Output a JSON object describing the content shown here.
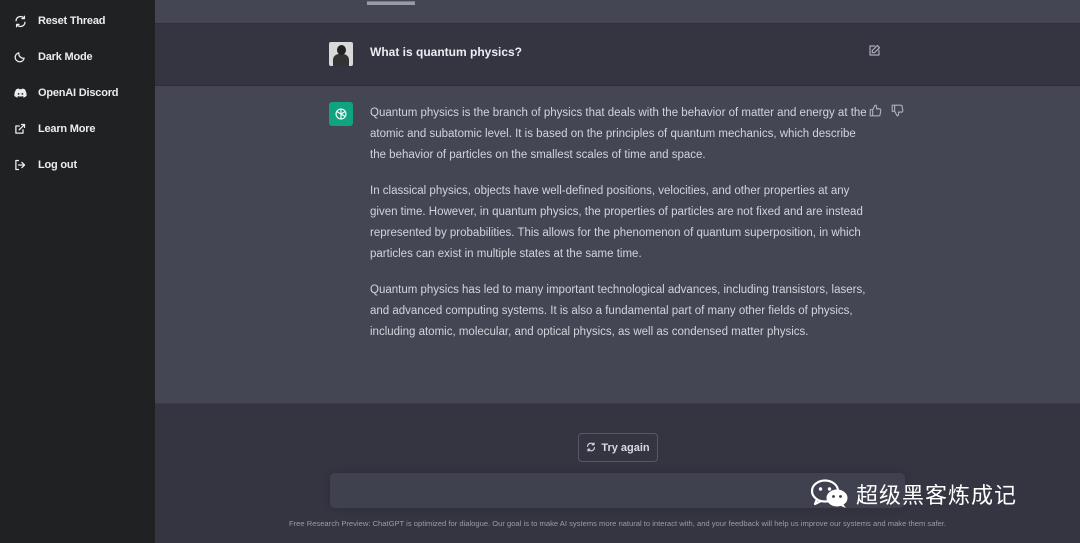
{
  "sidebar": {
    "items": [
      {
        "label": "Reset Thread",
        "icon": "refresh-icon"
      },
      {
        "label": "Dark Mode",
        "icon": "moon-icon"
      },
      {
        "label": "OpenAI Discord",
        "icon": "discord-icon"
      },
      {
        "label": "Learn More",
        "icon": "external-link-icon"
      },
      {
        "label": "Log out",
        "icon": "logout-icon"
      }
    ]
  },
  "conversation": {
    "user_message": "What is quantum physics?",
    "assistant_paragraphs": [
      "Quantum physics is the branch of physics that deals with the behavior of matter and energy at the atomic and subatomic level. It is based on the principles of quantum mechanics, which describe the behavior of particles on the smallest scales of time and space.",
      "In classical physics, objects have well-defined positions, velocities, and other properties at any given time. However, in quantum physics, the properties of particles are not fixed and are instead represented by probabilities. This allows for the phenomenon of quantum superposition, in which particles can exist in multiple states at the same time.",
      "Quantum physics has led to many important technological advances, including transistors, lasers, and advanced computing systems. It is also a fundamental part of many other fields of physics, including atomic, molecular, and optical physics, as well as condensed matter physics."
    ]
  },
  "actions": {
    "try_again_label": "Try again"
  },
  "composer": {
    "value": "",
    "placeholder": ""
  },
  "footer": {
    "text": "Free Research Preview: ChatGPT is optimized for dialogue. Our goal is to make AI systems more natural to interact with, and your feedback will help us improve our systems and make them safer."
  },
  "watermark": {
    "text": "超级黑客炼成记"
  },
  "colors": {
    "sidebar_bg": "#202123",
    "main_bg": "#343541",
    "assistant_bg": "#444654",
    "accent": "#10a37f"
  }
}
